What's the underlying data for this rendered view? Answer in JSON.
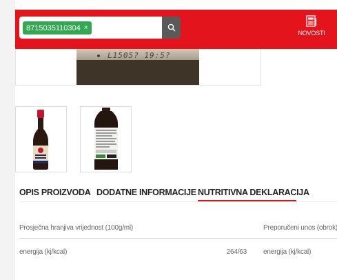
{
  "header": {
    "search_tag": "8715035110304",
    "tag_remove": "×",
    "news_label": "NOVOSTI"
  },
  "main_image": {
    "lot_code": "L1505? 19:5?"
  },
  "tabs": [
    {
      "label": "OPIS PROIZVODA",
      "active": false
    },
    {
      "label": "DODATNE INFORMACIJE",
      "active": false
    },
    {
      "label": "NUTRITIVNA DEKLARACIJA",
      "active": true
    }
  ],
  "nutrition": {
    "col_left": "Prosječna hranjiva vrijednost (100g/ml)",
    "col_right": "Preporučeni unos (obrok)",
    "rows": [
      {
        "name": "energija (kj/kcal)",
        "value": "264/63",
        "right": "energija (kj/kcal)"
      }
    ]
  },
  "colors": {
    "brand_red": "#e3141b",
    "tag_green": "#32a852",
    "search_button": "#5a5a5a"
  },
  "icons": {
    "search": "search-icon",
    "news": "newspaper-icon",
    "remove": "close-icon"
  }
}
